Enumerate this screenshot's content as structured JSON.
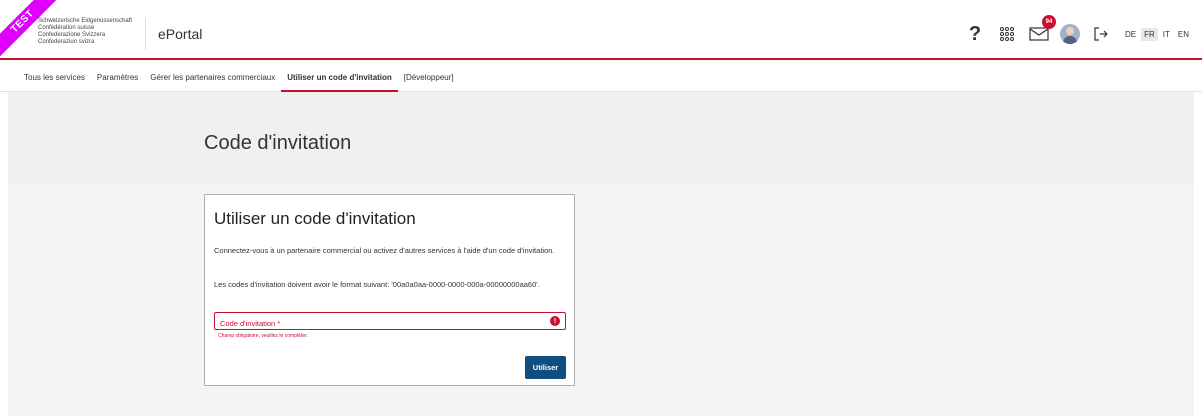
{
  "header": {
    "test_ribbon": "TEST",
    "logo_lines": [
      "Schweizerische Eidgenossenschaft",
      "Confédération suisse",
      "Confederazione Svizzera",
      "Confederaziun svizra"
    ],
    "app_title": "ePortal",
    "help_label": "?",
    "mail_badge_count": "94",
    "languages": [
      "DE",
      "FR",
      "IT",
      "EN"
    ],
    "active_language": "FR",
    "icons": {
      "apps": "apps-grid-icon",
      "mail": "mail-icon",
      "logout": "logout-icon"
    }
  },
  "tabs": [
    {
      "label": "Tous les services"
    },
    {
      "label": "Paramètres"
    },
    {
      "label": "Gérer les partenaires commerciaux"
    },
    {
      "label": "Utiliser un code d'invitation"
    },
    {
      "label": "[Développeur]"
    }
  ],
  "active_tab": "Utiliser un code d'invitation",
  "hero": {
    "title": "Code d'invitation"
  },
  "card": {
    "title": "Utiliser un code d'invitation",
    "p1": "Connectez-vous à un partenaire commercial ou activez d'autres services à l'aide d'un code d'invitation.",
    "p2": "Les codes d'invitation doivent avoir le format suivant: '00a0a0aa-0000-0000-000a-00000000aa60'.",
    "input_placeholder": "Code d'invitation *",
    "input_value": "",
    "error_message": "Champ obligatoire, veuillez le compléter.",
    "submit_label": "Utiliser"
  },
  "colors": {
    "accent_red": "#c8102e",
    "primary_blue": "#0f4f7f",
    "test_magenta": "#e000ff"
  }
}
